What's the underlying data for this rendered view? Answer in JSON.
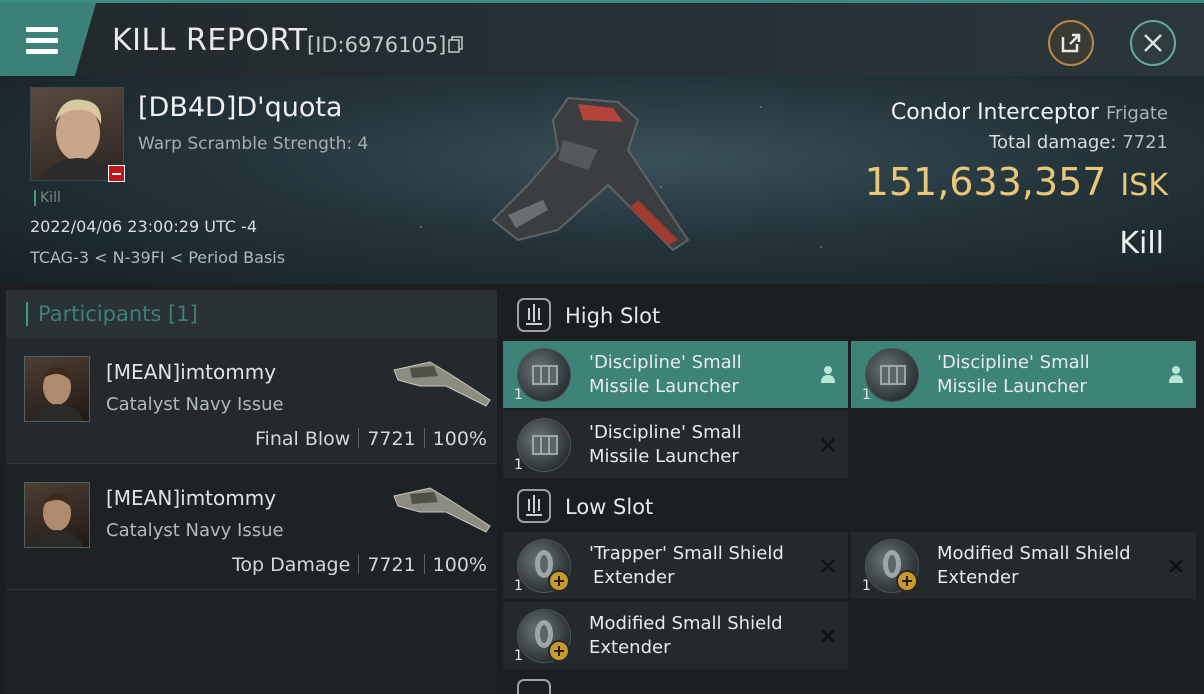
{
  "header": {
    "title": "KILL REPORT",
    "report_id": "[ID:6976105]",
    "icons": {
      "menu": "hamburger-menu-icon",
      "copy": "copy-icon",
      "share": "share-icon",
      "close": "close-icon"
    }
  },
  "victim": {
    "name": "[DB4D]D'quota",
    "warp_scramble": "Warp Scramble Strength: 4",
    "kill_tag": "Kill",
    "datetime": "2022/04/06 23:00:29 UTC -4",
    "location": "TCAG-3 < N-39FI < Period Basis",
    "ship_name": "Condor Interceptor",
    "ship_class": "Frigate",
    "total_damage_label": "Total damage:",
    "total_damage_value": "7721",
    "isk_value": "151,633,357",
    "isk_unit": "ISK",
    "result": "Kill"
  },
  "participants": {
    "title": "Participants",
    "count": "[1]",
    "rows": [
      {
        "name": "[MEAN]imtommy",
        "ship": "Catalyst Navy Issue",
        "role": "Final Blow",
        "damage": "7721",
        "percent": "100%"
      },
      {
        "name": "[MEAN]imtommy",
        "ship": "Catalyst Navy Issue",
        "role": "Top Damage",
        "damage": "7721",
        "percent": "100%"
      }
    ]
  },
  "fitting": {
    "high_slot": {
      "title": "High Slot",
      "items": [
        {
          "line1": "'Discipline' Small",
          "line2": "Missile Launcher",
          "qty": "1",
          "state": "person-icon"
        },
        {
          "line1": "'Discipline' Small",
          "line2": "Missile Launcher",
          "qty": "1",
          "state": "person-icon"
        },
        {
          "line1": "'Discipline' Small",
          "line2": "Missile Launcher",
          "qty": "1",
          "state": "destroyed-x-icon"
        }
      ]
    },
    "low_slot": {
      "title": "Low Slot",
      "items": [
        {
          "line1": "'Trapper' Small Shield",
          "line2": "Extender",
          "qty": "1",
          "state": "destroyed-x-icon"
        },
        {
          "line1": "Modified Small Shield",
          "line2": "Extender",
          "qty": "1",
          "state": "destroyed-x-icon"
        },
        {
          "line1": "Modified Small Shield",
          "line2": "Extender",
          "qty": "1",
          "state": "destroyed-x-icon"
        }
      ]
    }
  },
  "colors": {
    "accent": "#3d8378",
    "isk": "#e9c778",
    "destroyed_badge": "#c01818"
  }
}
